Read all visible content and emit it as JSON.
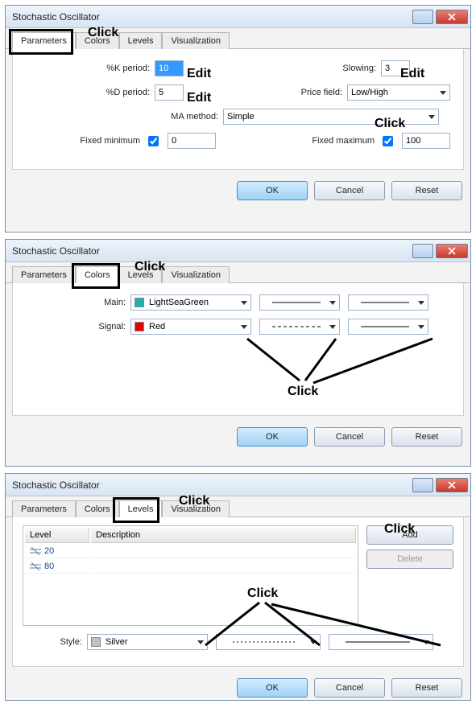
{
  "dialogs": [
    {
      "title": "Stochastic Oscillator",
      "tabs": [
        "Parameters",
        "Colors",
        "Levels",
        "Visualization"
      ],
      "active_tab": 0,
      "anno_tab_label": "Click",
      "params": {
        "k_label": "%K period:",
        "k_value": "10",
        "k_anno": "Edit",
        "d_label": "%D period:",
        "d_value": "5",
        "d_anno": "Edit",
        "slowing_label": "Slowing:",
        "slowing_value": "3",
        "slowing_anno": "Edit",
        "price_label": "Price field:",
        "price_value": "Low/High",
        "ma_label": "MA method:",
        "ma_value": "Simple",
        "ma_anno": "Click",
        "fixed_min_label": "Fixed minimum",
        "fixed_min_checked": true,
        "fixed_min_value": "0",
        "fixed_max_label": "Fixed maximum",
        "fixed_max_checked": true,
        "fixed_max_value": "100",
        "ok": "OK",
        "cancel": "Cancel",
        "reset": "Reset"
      }
    },
    {
      "title": "Stochastic Oscillator",
      "tabs": [
        "Parameters",
        "Colors",
        "Levels",
        "Visualization"
      ],
      "active_tab": 1,
      "anno_tab_label": "Click",
      "anno_click": "Click",
      "colors": {
        "main_label": "Main:",
        "main_value": "LightSeaGreen",
        "main_swatch": "#20B2AA",
        "signal_label": "Signal:",
        "signal_value": "Red",
        "signal_swatch": "#E60000",
        "ok": "OK",
        "cancel": "Cancel",
        "reset": "Reset"
      }
    },
    {
      "title": "Stochastic Oscillator",
      "tabs": [
        "Parameters",
        "Colors",
        "Levels",
        "Visualization"
      ],
      "active_tab": 2,
      "anno_tab_label": "Click",
      "anno_click": "Click",
      "anno_add": "Click",
      "levels": {
        "level_header": "Level",
        "desc_header": "Description",
        "rows": [
          {
            "level": "20",
            "desc": ""
          },
          {
            "level": "80",
            "desc": ""
          }
        ],
        "add": "Add",
        "delete": "Delete",
        "style_label": "Style:",
        "style_value": "Silver",
        "style_swatch": "#C0C0C0",
        "ok": "OK",
        "cancel": "Cancel",
        "reset": "Reset"
      }
    }
  ]
}
